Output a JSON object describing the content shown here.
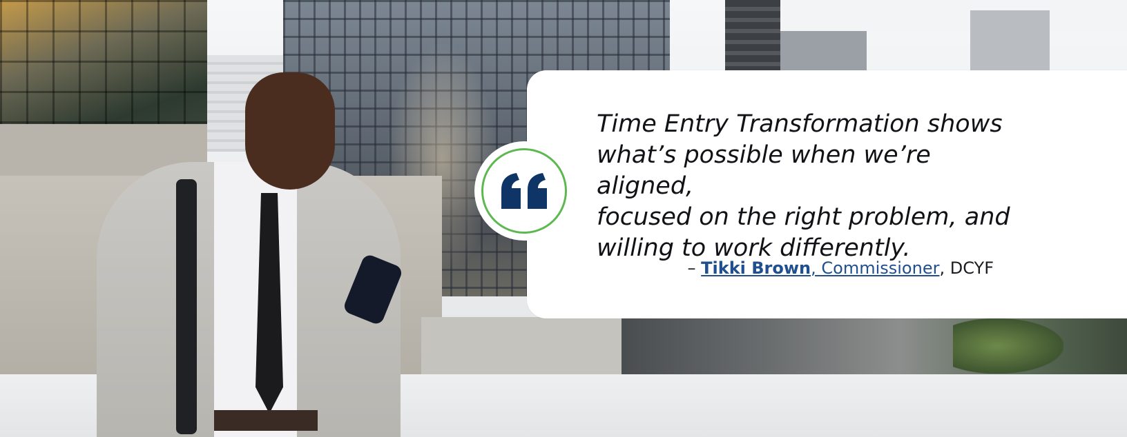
{
  "quote": {
    "lines": [
      "Time Entry Transformation shows",
      "what’s possible when we’re aligned,",
      "focused on the right problem, and",
      "willing to work differently."
    ],
    "icon": "quote-mark-icon"
  },
  "attribution": {
    "dash": "– ",
    "name": "Tikki Brown",
    "title": ", Commissioner",
    "org": ", DCYF"
  },
  "colors": {
    "quote_icon": "#0f3566",
    "ring": "#5cb84f",
    "link": "#1f4f8f"
  }
}
